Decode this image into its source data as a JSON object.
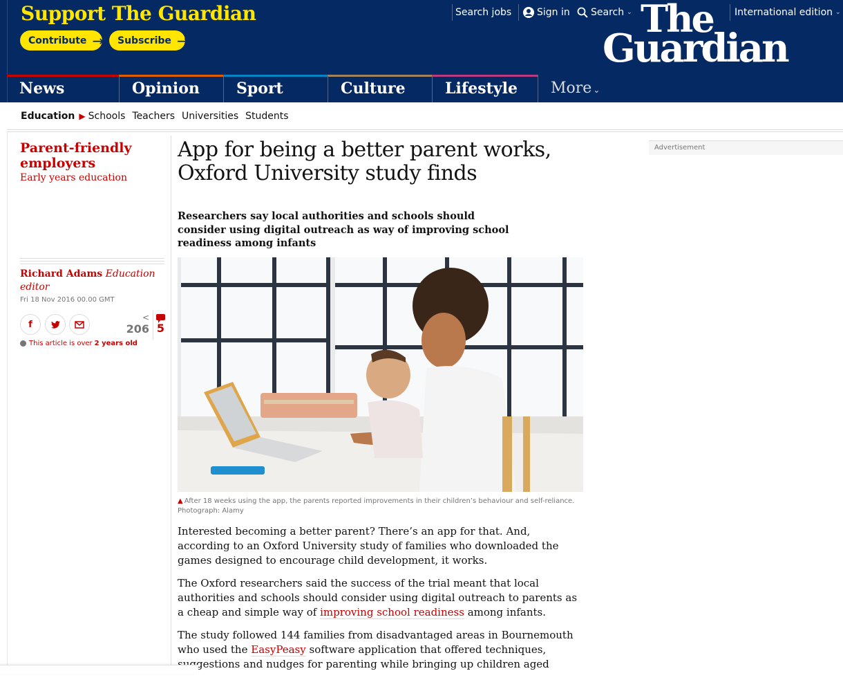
{
  "header": {
    "support_title": "Support The Guardian",
    "contribute_label": "Contribute",
    "subscribe_label": "Subscribe",
    "search_jobs": "Search jobs",
    "sign_in": "Sign in",
    "search": "Search",
    "edition": "International edition",
    "logo_the": "The",
    "logo_guardian": "Guardian",
    "colors": {
      "background": "#052962",
      "accent": "#ffe500"
    }
  },
  "nav": {
    "items": [
      {
        "label": "News",
        "color": "#c70000"
      },
      {
        "label": "Opinion",
        "color": "#e05e00"
      },
      {
        "label": "Sport",
        "color": "#0084c6"
      },
      {
        "label": "Culture",
        "color": "#a1845c"
      },
      {
        "label": "Lifestyle",
        "color": "#bb3b80"
      }
    ],
    "more_label": "More"
  },
  "subnav": {
    "current": "Education",
    "links": [
      "Schools",
      "Teachers",
      "Universities",
      "Students"
    ]
  },
  "meta": {
    "series_name": "Parent-friendly employers",
    "series_sub": "Early years education",
    "author": "Richard Adams",
    "role": "Education editor",
    "date": "Fri 18 Nov 2016 00.00 GMT",
    "share_count": "206",
    "comment_count": "5",
    "age_notice_prefix": "This article is over",
    "age_notice_bold": "2 years old"
  },
  "article": {
    "headline": "App for being a better parent works, Oxford University study finds",
    "standfirst": "Researchers say local authorities and schools should consider using digital outreach as way of improving school readiness among infants",
    "caption": "After 18 weeks using the app, the parents reported improvements in their children’s behaviour and self-reliance.",
    "credit": "Photograph: Alamy",
    "p1": "Interested becoming a better parent? There’s an app for that. And, according to an Oxford University study of families who downloaded the games designed to encourage child development, it works.",
    "p2_before": "The Oxford researchers said the success of the trial meant that local authorities and schools should consider using digital outreach to parents as a cheap and simple way of ",
    "p2_link": "improving school readiness",
    "p2_after": " among infants.",
    "p3_before": "The study followed 144 families from disadvantaged areas in Bournemouth who used the ",
    "p3_link": "EasyPeasy",
    "p3_after": " software application that offered techniques, suggestions and nudges for parenting while bringing up children aged"
  },
  "advert_label": "Advertisement"
}
